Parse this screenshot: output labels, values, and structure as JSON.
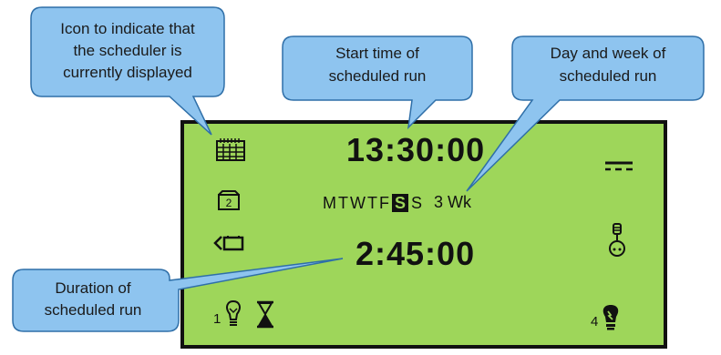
{
  "callouts": {
    "icon_note": [
      "Icon to indicate that",
      "the scheduler is",
      "currently displayed"
    ],
    "start_note": [
      "Start time of",
      "scheduled run"
    ],
    "day_note": [
      "Day and week of",
      "scheduled run"
    ],
    "duration_note": [
      "Duration of",
      "scheduled run"
    ]
  },
  "display": {
    "start_time": "13:30:00",
    "duration": "2:45:00",
    "days": [
      "M",
      "T",
      "W",
      "T",
      "F",
      "S",
      "S"
    ],
    "selected_day_index": 5,
    "week": "3 Wk",
    "zone_number": "1",
    "program_number": "4"
  },
  "colors": {
    "lcd_background": "#9ed65a",
    "callout_fill": "#8ec4ef",
    "callout_stroke": "#2f6fa8",
    "text": "#111111"
  },
  "icons": {
    "scheduler": "calendar-icon",
    "calendar_2": "calendar-two-icon",
    "battery": "battery-icon",
    "power": "dc-power-icon",
    "sensor": "sensor-probe-icon",
    "zone": "lightbulb-icon",
    "timer": "hourglass-icon",
    "program": "bulb-flash-icon"
  }
}
